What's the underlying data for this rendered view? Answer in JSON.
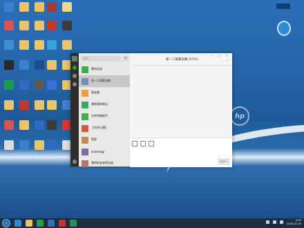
{
  "desktop": {
    "icons": [
      {
        "label": "",
        "color": "#3c7fd1"
      },
      {
        "label": "",
        "color": "#e9c46a"
      },
      {
        "label": "",
        "color": "#f0c05a"
      },
      {
        "label": "",
        "color": "#a13a3a"
      },
      {
        "label": "",
        "color": "#f0d78a"
      },
      {
        "label": "",
        "color": "#d9534f"
      },
      {
        "label": "",
        "color": "#e8c36a"
      },
      {
        "label": "",
        "color": "#e9c46a"
      },
      {
        "label": "",
        "color": "#c0392b"
      },
      {
        "label": "",
        "color": "#3c3c3c"
      },
      {
        "label": "",
        "color": "#3a8fd6"
      },
      {
        "label": "",
        "color": "#e9c46a"
      },
      {
        "label": "",
        "color": "#e9c46a"
      },
      {
        "label": "",
        "color": "#36a3e0"
      },
      {
        "label": "",
        "color": "#e9c46a"
      },
      {
        "label": "",
        "color": "#2a2a2a"
      },
      {
        "label": "",
        "color": "#3c7fd1"
      },
      {
        "label": "",
        "color": "#1b4f8b"
      },
      {
        "label": "",
        "color": "#e9c46a"
      },
      {
        "label": "",
        "color": "#e9c46a"
      },
      {
        "label": "",
        "color": "#1b9a4b"
      },
      {
        "label": "",
        "color": "#2d6cc0"
      },
      {
        "label": "",
        "color": "#5a5a5a"
      },
      {
        "label": "",
        "color": "#3a6fd6"
      },
      {
        "label": "",
        "color": "#e9c46a"
      },
      {
        "label": "",
        "color": "#e9c46a"
      },
      {
        "label": "",
        "color": "#c0392b"
      },
      {
        "label": "",
        "color": "#e9c46a"
      },
      {
        "label": "",
        "color": "#e9c46a"
      },
      {
        "label": "",
        "color": "#3c7fd1"
      },
      {
        "label": "",
        "color": "#d9534f"
      },
      {
        "label": "",
        "color": "#e9c46a"
      },
      {
        "label": "",
        "color": "#2d6cc0"
      },
      {
        "label": "",
        "color": "#3c3c3c"
      },
      {
        "label": "",
        "color": "#d33"
      },
      {
        "label": "",
        "color": "#ddd"
      },
      {
        "label": "",
        "color": "#3c7fd1"
      },
      {
        "label": "",
        "color": "#e9c46a"
      },
      {
        "label": "",
        "color": "#2d6cc0"
      },
      {
        "label": "",
        "color": "#ddd"
      }
    ]
  },
  "wechat": {
    "search_placeholder": "搜索",
    "plus": "+",
    "title": "初一二班家长群 (57人)",
    "more": "···",
    "window_controls": "— □ ✕",
    "send_label": "发送(S)",
    "chats": [
      {
        "name": "微信运动",
        "sub": "",
        "time": "",
        "color": "#34b24b",
        "active": false
      },
      {
        "name": "初一二班家长群",
        "sub": "",
        "time": "",
        "color": "#6d8fb8",
        "active": true
      },
      {
        "name": "朋友圈",
        "sub": "",
        "time": "",
        "color": "#e9a23b",
        "active": false
      },
      {
        "name": "我的简单笔记",
        "sub": "",
        "time": "",
        "color": "#3fa46a",
        "active": false
      },
      {
        "name": "文件传输助手",
        "sub": "",
        "time": "",
        "color": "#3fae4f",
        "active": false
      },
      {
        "name": "【光声心理】",
        "sub": "",
        "time": "",
        "color": "#d15b3a",
        "active": false
      },
      {
        "name": "家庭",
        "sub": "",
        "time": "",
        "color": "#c28c5a",
        "active": false
      },
      {
        "name": "xiaoxingy",
        "sub": "",
        "time": "",
        "color": "#7a6aa8",
        "active": false
      },
      {
        "name": "我的好友亲如兄弟",
        "sub": "",
        "time": "",
        "color": "#b0746a",
        "active": false
      }
    ]
  },
  "taskbar": {
    "time": "9:59",
    "date": "2018-01-19",
    "apps": [
      "#2d8ad6",
      "#e8c36a",
      "#1fa44a",
      "#3b6fb4",
      "#c0392b",
      "#2a8f5a"
    ]
  }
}
